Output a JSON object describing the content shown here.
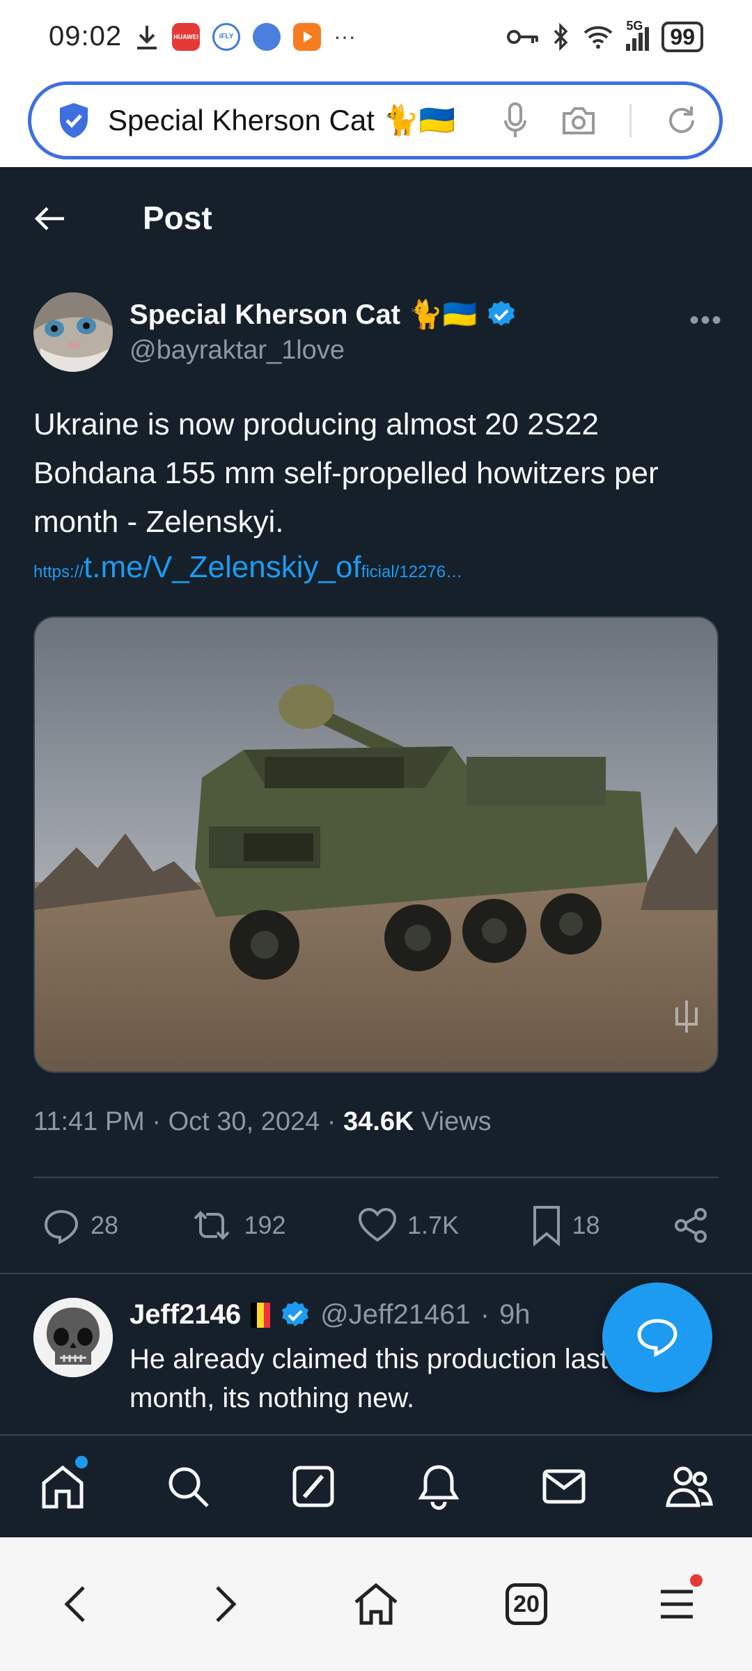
{
  "status_bar": {
    "time": "09:02",
    "apps": [
      "HUAWEI",
      "iFLY"
    ],
    "overflow": "···",
    "network": "5G",
    "battery": "99",
    "icons": [
      "download-icon",
      "huawei-app-icon",
      "ifly-icon",
      "browser-app-icon",
      "video-app-icon",
      "key-icon",
      "bluetooth-icon",
      "wifi-icon",
      "signal-icon"
    ]
  },
  "url_bar": {
    "text": "Special Kherson Cat 🐈🇺🇦 ",
    "icons": [
      "shield-icon",
      "mic-icon",
      "camera-icon",
      "reload-icon"
    ]
  },
  "header": {
    "title": "Post"
  },
  "tweet": {
    "author_name": "Special Kherson Cat 🐈🇺🇦",
    "author_handle": "@bayraktar_1love",
    "more": "•••",
    "text": "Ukraine is now producing almost 20 2S22 Bohdana 155 mm self-propelled howitzers per month - Zelenskyi.",
    "link_prefix": "https://",
    "link_main": "t.me/V_Zelenskiy_of",
    "link_suffix": "ficial/12276…",
    "time": "11:41 PM",
    "date": "Oct 30, 2024",
    "views_count": "34.6K",
    "views_label": "Views",
    "separator": "·",
    "stats": {
      "replies": "28",
      "reposts": "192",
      "likes": "1.7K",
      "bookmarks": "18"
    }
  },
  "reply": {
    "name": "Jeff2146",
    "handle": "@Jeff21461",
    "age": "9h",
    "separator": "·",
    "text": "He already claimed this production last month, its nothing new."
  },
  "tab_bar": {
    "items": [
      "home-icon",
      "search-icon",
      "grok-icon",
      "notifications-icon",
      "messages-icon",
      "communities-icon"
    ]
  },
  "browser_bar": {
    "tab_count": "20"
  },
  "colors": {
    "background": "#15202b",
    "accent": "#1d9bf0",
    "muted": "#8b98a5",
    "url_border": "#3d6fe0"
  }
}
